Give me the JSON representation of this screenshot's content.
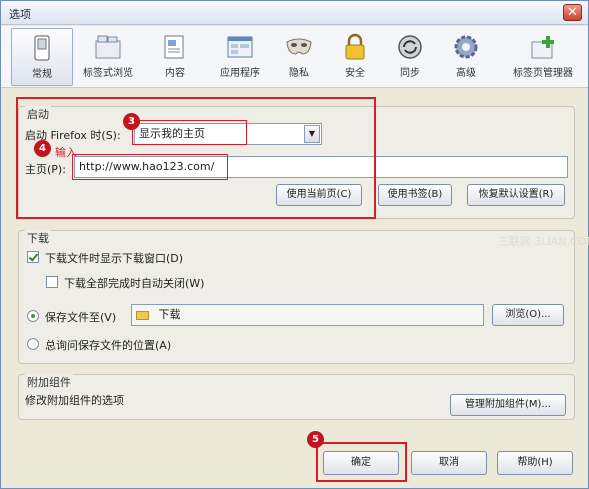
{
  "window": {
    "title": "选项",
    "close_glyph": "✕"
  },
  "toolbar": {
    "items": [
      {
        "label": "常规",
        "icon": "switch-icon",
        "active": true
      },
      {
        "label": "标签式浏览",
        "icon": "tabs-icon"
      },
      {
        "label": "内容",
        "icon": "content-icon"
      },
      {
        "label": "应用程序",
        "icon": "applications-icon"
      },
      {
        "label": "隐私",
        "icon": "mask-icon"
      },
      {
        "label": "安全",
        "icon": "lock-icon"
      },
      {
        "label": "同步",
        "icon": "sync-icon"
      },
      {
        "label": "高级",
        "icon": "gear-icon"
      },
      {
        "label": "标签页管理器",
        "icon": "add-tab-icon"
      }
    ]
  },
  "startup": {
    "title": "启动",
    "when_label": "启动 Firefox 时(S):",
    "when_value": "显示我的主页",
    "home_label": "主页(P):",
    "home_value": "http://www.hao123.com/",
    "use_current_label": "使用当前页(C)",
    "use_bookmark_label": "使用书签(B)",
    "restore_default_label": "恢复默认设置(R)"
  },
  "downloads": {
    "title": "下载",
    "show_window_label": "下载文件时显示下载窗口(D)",
    "close_when_done_label": "下载全部完成时自动关闭(W)",
    "save_to_label": "保存文件至(V)",
    "save_to_value": "下载",
    "browse_label": "浏览(O)...",
    "always_ask_label": "总询问保存文件的位置(A)"
  },
  "addons": {
    "title": "附加组件",
    "desc": "修改附加组件的选项",
    "manage_label": "管理附加组件(M)..."
  },
  "footer": {
    "ok_label": "确定",
    "cancel_label": "取消",
    "help_label": "帮助(H)"
  },
  "annotations": {
    "badge3": "3",
    "badge4": "4",
    "badge5": "5",
    "input_hint": "输入"
  },
  "watermark": "三联网 3LIAN.COM",
  "colors": {
    "annotation_red": "#d61e2a",
    "window_bg": "#ece9d8",
    "toolbar_bg": "#f4f6f9"
  }
}
